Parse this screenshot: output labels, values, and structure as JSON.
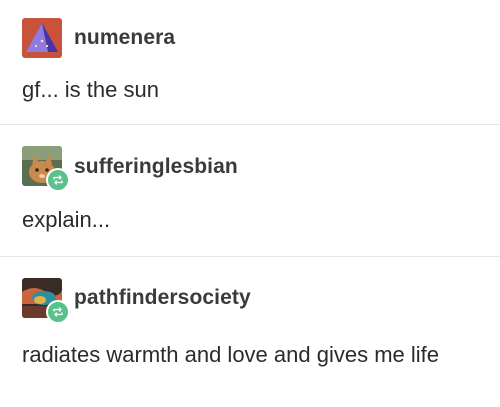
{
  "posts": [
    {
      "username": "numenera",
      "text": "gf... is the sun",
      "avatar_icon": "purple-pyramid-icon",
      "reblogged": false
    },
    {
      "username": "sufferinglesbian",
      "text": "explain...",
      "avatar_icon": "cat-photo-avatar",
      "reblogged": true
    },
    {
      "username": "pathfindersociety",
      "text": "radiates warmth and love and gives me life",
      "avatar_icon": "colorful-art-avatar",
      "reblogged": true
    }
  ],
  "colors": {
    "reblog_badge": "#59c28a",
    "divider": "#e6e6e6",
    "text": "#2b2b2b"
  }
}
